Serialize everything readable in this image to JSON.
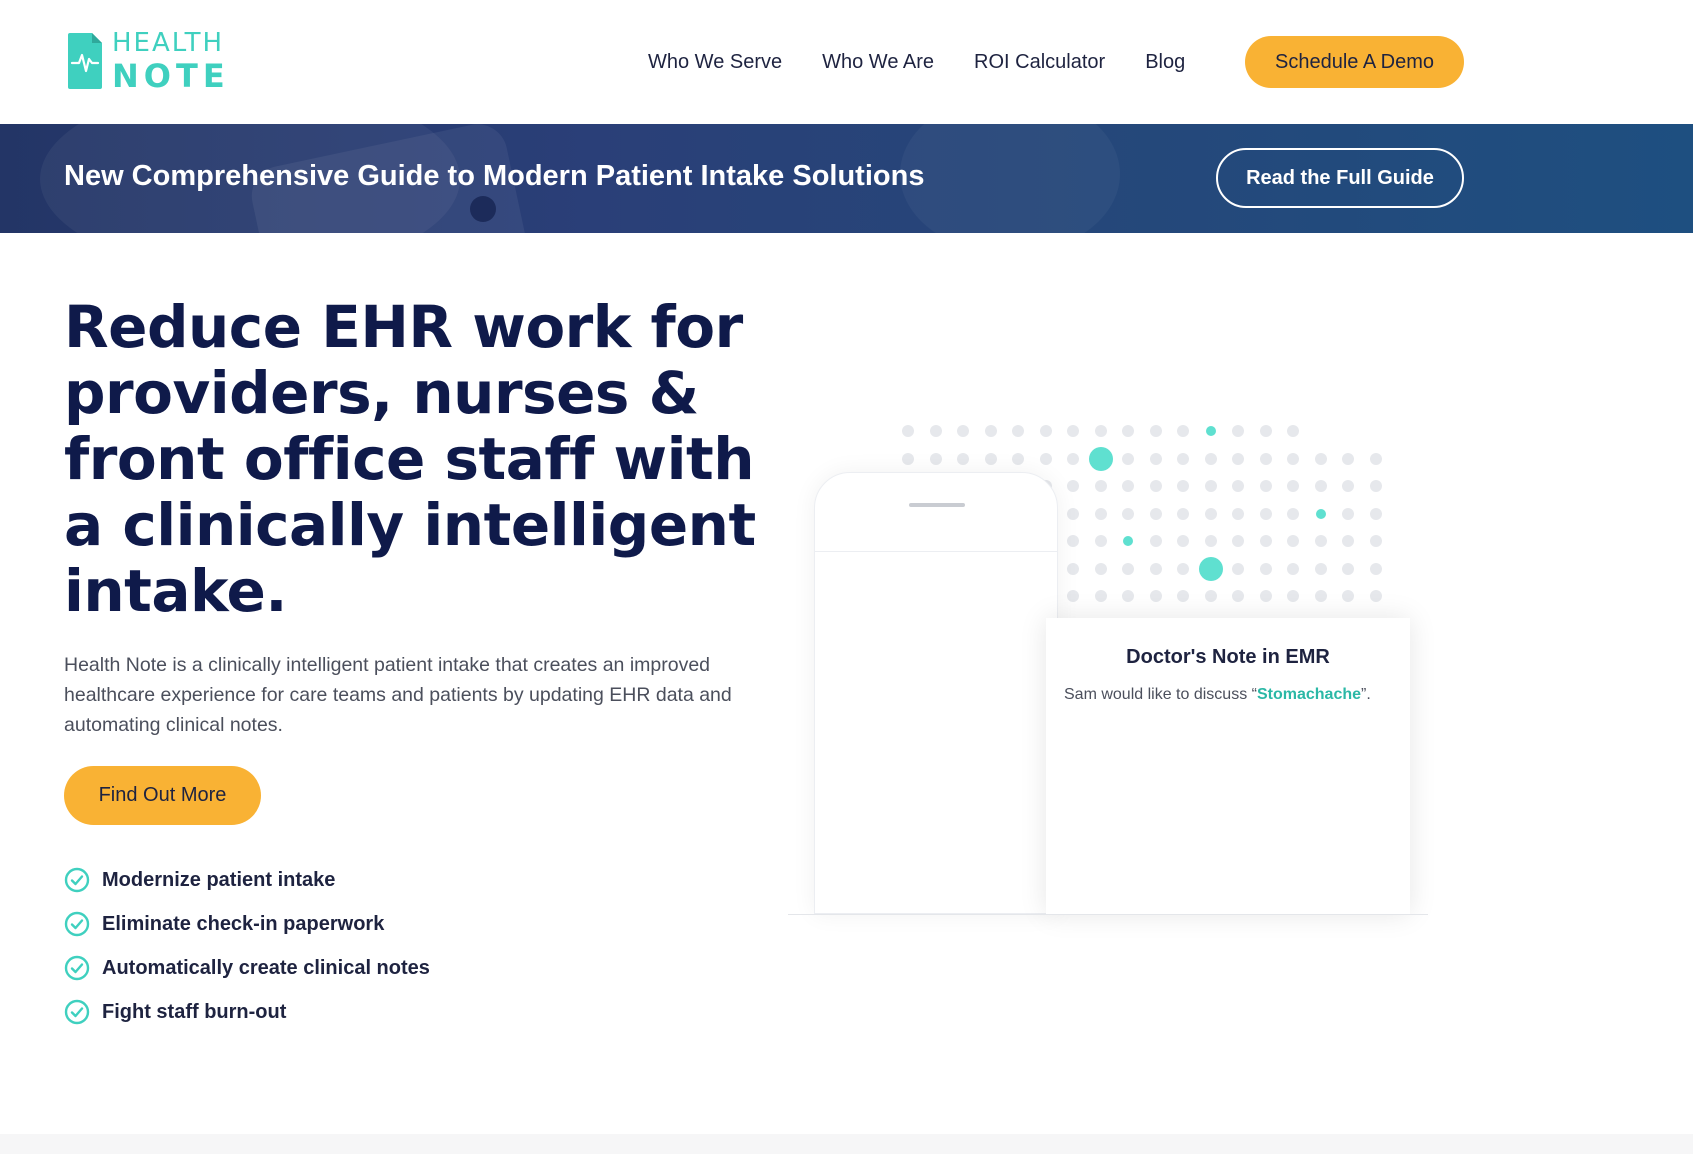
{
  "brand": {
    "line1": "HEALTH",
    "line2": "NOTE",
    "accent": "#3fd0bf"
  },
  "nav": {
    "items": [
      "Who We Serve",
      "Who We Are",
      "ROI Calculator",
      "Blog"
    ],
    "cta": "Schedule A Demo"
  },
  "banner": {
    "title": "New Comprehensive Guide to Modern Patient Intake Solutions",
    "button": "Read the Full Guide"
  },
  "hero": {
    "title": "Reduce EHR work for providers, nurses & front office staff with a clinically intelligent intake.",
    "description": "Health Note is a clinically intelligent patient intake that creates an improved healthcare experience for care teams and patients by updating EHR data and automating clinical notes.",
    "button": "Find Out More",
    "features": [
      "Modernize patient intake",
      "Eliminate check-in paperwork",
      "Automatically create clinical notes",
      "Fight staff burn-out"
    ]
  },
  "illustration": {
    "note_title": "Doctor's Note in EMR",
    "note_prefix": "Sam would like to discuss “",
    "note_highlight": "Stomachache",
    "note_suffix": "”."
  },
  "colors": {
    "orange": "#f9b234",
    "navy": "#0f1a4a",
    "teal": "#3fd0bf"
  }
}
